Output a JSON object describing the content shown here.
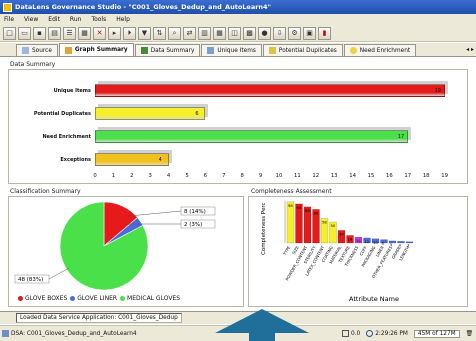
{
  "window": {
    "title": "DataLens Governance Studio - \"C001_Gloves_Dedup_and_AutoLearn4\""
  },
  "menu": [
    "File",
    "View",
    "Edit",
    "Run",
    "Tools",
    "Help"
  ],
  "tabs": [
    "Source",
    "Graph Summary",
    "Data Summary",
    "Unique Items",
    "Potential Duplicates",
    "Need Enrichment"
  ],
  "panels": {
    "data_summary": "Data Summary",
    "classification": "Classification Summary",
    "completeness": "Completeness Assessment"
  },
  "colors": {
    "red": "#e61a1a",
    "yellow": "#f5f02a",
    "green": "#49e049",
    "orange": "#f2c21c",
    "blue": "#4b6bdb"
  },
  "chart_data": [
    {
      "type": "bar",
      "orientation": "horizontal",
      "title": "Data Summary",
      "categories": [
        "Unique Items",
        "Potential Duplicates",
        "Need Enrichment",
        "Exceptions"
      ],
      "values": [
        19,
        6,
        17,
        4
      ],
      "colors": [
        "#e61a1a",
        "#f5f02a",
        "#49e049",
        "#f2c21c"
      ],
      "xlim": [
        0,
        19
      ],
      "xticks": [
        "0",
        "1",
        "2",
        "3",
        "4",
        "5",
        "6",
        "7",
        "8",
        "9",
        "10",
        "11",
        "12",
        "13",
        "14",
        "15",
        "16",
        "17",
        "18",
        "19"
      ]
    },
    {
      "type": "pie",
      "title": "Classification Summary",
      "slices": [
        {
          "label": "GLOVE BOXES",
          "value": 8,
          "percent": "14%",
          "text": "8 (14%)",
          "color": "#e61a1a"
        },
        {
          "label": "GLOVE LINER",
          "value": 2,
          "percent": "3%",
          "text": "2 (3%)",
          "color": "#4b6bdb"
        },
        {
          "label": "MEDICAL GLOVES",
          "value": 48,
          "percent": "83%",
          "text": "48 (83%)",
          "color": "#49e049"
        }
      ]
    },
    {
      "type": "bar",
      "title": "Completeness Assessment",
      "xlabel": "Attribute Name",
      "ylabel": "Completeness Perc",
      "categories": [
        "TYPE",
        "SIZE",
        "POWDER_CONTENT",
        "STERILITY",
        "LATEX_CONTENT",
        "COATING",
        "MATERIAL",
        "TEXTURE",
        "THICKNESS",
        "CUFF",
        "PACKAGING",
        "LINER",
        "OTHER_FEATURES",
        "GRADE",
        "LENGTH"
      ],
      "values": [
        98,
        93,
        86,
        80,
        58,
        50,
        30,
        18,
        14,
        12,
        10,
        8,
        5,
        4,
        3
      ],
      "value_labels": [
        "98",
        "93",
        "86",
        "80",
        "58",
        "50",
        "30",
        "18",
        "14",
        "12",
        "10",
        "8",
        "5",
        "4",
        "3"
      ],
      "colors": [
        "#f5f02a",
        "#e61a1a",
        "#e61a1a",
        "#e61a1a",
        "#f5f02a",
        "#f5f02a",
        "#e61a1a",
        "#e61a1a",
        "#c73fd6",
        "#4b6bdb",
        "#4b6bdb",
        "#4b6bdb",
        "#4b6bdb",
        "#4b6bdb",
        "#4b6bdb"
      ],
      "ylim": [
        0,
        100
      ]
    }
  ],
  "status": {
    "message": "Loaded Data Service Application: C001_Gloves_Dedup",
    "dsa": "DSA: C001_Gloves_Dedup_and_AutoLearn4",
    "count": "0.0",
    "time": "2:29:26 PM",
    "memory": "45M of 127M"
  }
}
